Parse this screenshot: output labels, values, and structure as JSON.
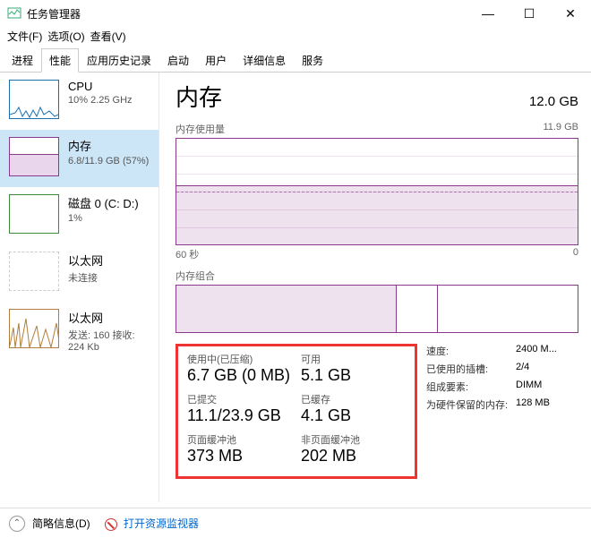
{
  "window": {
    "title": "任务管理器",
    "controls": {
      "min": "—",
      "max": "☐",
      "close": "✕"
    }
  },
  "menu": {
    "file": "文件(F)",
    "options": "选项(O)",
    "view": "查看(V)"
  },
  "tabs": {
    "processes": "进程",
    "performance": "性能",
    "history": "应用历史记录",
    "startup": "启动",
    "users": "用户",
    "details": "详细信息",
    "services": "服务"
  },
  "sidebar": {
    "cpu": {
      "title": "CPU",
      "sub": "10% 2.25 GHz"
    },
    "mem": {
      "title": "内存",
      "sub": "6.8/11.9 GB (57%)"
    },
    "disk": {
      "title": "磁盘 0 (C: D:)",
      "sub": "1%"
    },
    "eth1": {
      "title": "以太网",
      "sub": "未连接"
    },
    "eth2": {
      "title": "以太网",
      "sub": "发送: 160 接收: 224 Kb"
    }
  },
  "detail": {
    "title": "内存",
    "total": "12.0 GB",
    "usage_label": "内存使用量",
    "usage_max": "11.9 GB",
    "x_left": "60 秒",
    "x_right": "0",
    "comp_label": "内存组合",
    "stats": {
      "inuse_lbl": "使用中(已压缩)",
      "inuse_val": "6.7 GB (0 MB)",
      "avail_lbl": "可用",
      "avail_val": "5.1 GB",
      "commit_lbl": "已提交",
      "commit_val": "11.1/23.9 GB",
      "cached_lbl": "已缓存",
      "cached_val": "4.1 GB",
      "paged_lbl": "页面缓冲池",
      "paged_val": "373 MB",
      "nonpaged_lbl": "非页面缓冲池",
      "nonpaged_val": "202 MB"
    },
    "info": {
      "speed_k": "速度:",
      "speed_v": "2400 M...",
      "slots_k": "已使用的插槽:",
      "slots_v": "2/4",
      "form_k": "组成要素:",
      "form_v": "DIMM",
      "reserved_k": "为硬件保留的内存:",
      "reserved_v": "128 MB"
    }
  },
  "footer": {
    "brief": "简略信息(D)",
    "open_monitor": "打开资源监视器"
  },
  "chart_data": {
    "type": "area",
    "title": "内存使用量",
    "xlabel": "60 秒",
    "ylabel": "",
    "ylim": [
      0,
      11.9
    ],
    "x_range_seconds": [
      60,
      0
    ],
    "series": [
      {
        "name": "使用中",
        "approx_value_gb": 6.7
      }
    ],
    "composition": {
      "total_gb": 11.9,
      "segments": [
        {
          "name": "使用中",
          "value_gb": 6.7
        },
        {
          "name": "已缓存/备用",
          "value_gb": 4.1
        },
        {
          "name": "可用",
          "value_gb": 1.1
        }
      ]
    }
  }
}
